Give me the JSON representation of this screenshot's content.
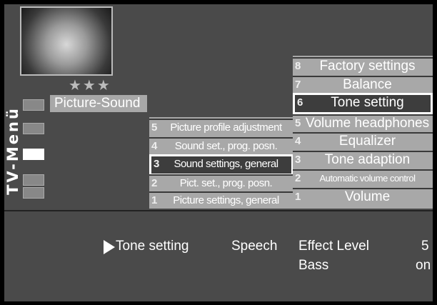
{
  "sidebar": {
    "title": "TV-Menü",
    "stars": "★★★",
    "category_label": "Picture-Sound"
  },
  "column2": [
    {
      "num": "5",
      "label": "Picture profile adjustment"
    },
    {
      "num": "4",
      "label": "Sound set., prog. posn."
    },
    {
      "num": "3",
      "label": "Sound settings, general"
    },
    {
      "num": "2",
      "label": "Pict. set., prog. posn."
    },
    {
      "num": "1",
      "label": "Picture settings, general"
    }
  ],
  "column3": [
    {
      "num": "8",
      "label": "Factory settings"
    },
    {
      "num": "7",
      "label": "Balance"
    },
    {
      "num": "6",
      "label": "Tone setting"
    },
    {
      "num": "5",
      "label": "Volume headphones"
    },
    {
      "num": "4",
      "label": "Equalizer"
    },
    {
      "num": "3",
      "label": "Tone adaption"
    },
    {
      "num": "2",
      "label": "Automatic volume control"
    },
    {
      "num": "1",
      "label": "Volume"
    }
  ],
  "status_bar": {
    "selected": "Tone setting",
    "mode": "Speech",
    "effect_label": "Effect Level",
    "effect_value": "5",
    "bass_label": "Bass",
    "bass_value": "on"
  }
}
